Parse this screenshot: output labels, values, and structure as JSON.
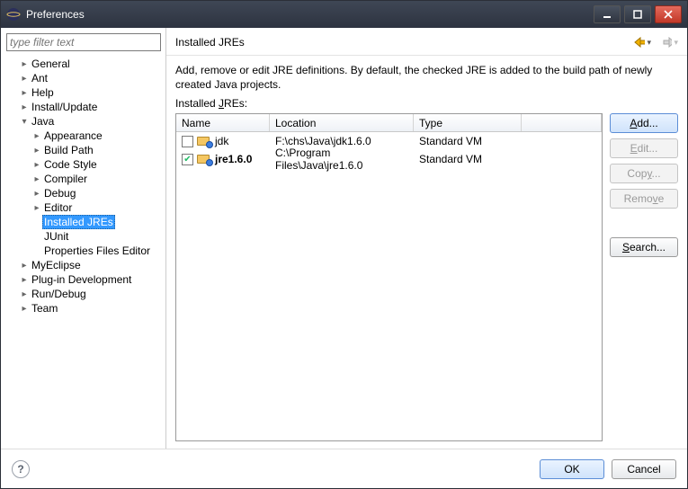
{
  "window": {
    "title": "Preferences"
  },
  "filter": {
    "placeholder": "type filter text"
  },
  "tree": {
    "items": [
      {
        "label": "General",
        "expandable": true,
        "level": 1
      },
      {
        "label": "Ant",
        "expandable": true,
        "level": 1
      },
      {
        "label": "Help",
        "expandable": true,
        "level": 1
      },
      {
        "label": "Install/Update",
        "expandable": true,
        "level": 1
      },
      {
        "label": "Java",
        "expandable": true,
        "expanded": true,
        "level": 1
      },
      {
        "label": "Appearance",
        "expandable": true,
        "level": 2
      },
      {
        "label": "Build Path",
        "expandable": true,
        "level": 2
      },
      {
        "label": "Code Style",
        "expandable": true,
        "level": 2
      },
      {
        "label": "Compiler",
        "expandable": true,
        "level": 2
      },
      {
        "label": "Debug",
        "expandable": true,
        "level": 2
      },
      {
        "label": "Editor",
        "expandable": true,
        "level": 2
      },
      {
        "label": "Installed JREs",
        "expandable": false,
        "level": 2,
        "selected": true
      },
      {
        "label": "JUnit",
        "expandable": false,
        "level": 2
      },
      {
        "label": "Properties Files Editor",
        "expandable": false,
        "level": 2
      },
      {
        "label": "MyEclipse",
        "expandable": true,
        "level": 1
      },
      {
        "label": "Plug-in Development",
        "expandable": true,
        "level": 1
      },
      {
        "label": "Run/Debug",
        "expandable": true,
        "level": 1
      },
      {
        "label": "Team",
        "expandable": true,
        "level": 1
      }
    ]
  },
  "main": {
    "title": "Installed JREs",
    "description": "Add, remove or edit JRE definitions. By default, the checked JRE is added to the build path of newly created Java projects.",
    "list_label_pre": "Installed ",
    "list_label_u": "J",
    "list_label_post": "REs:",
    "columns": {
      "name": "Name",
      "location": "Location",
      "type": "Type"
    },
    "rows": [
      {
        "checked": false,
        "name": "jdk",
        "location": "F:\\chs\\Java\\jdk1.6.0",
        "type": "Standard VM"
      },
      {
        "checked": true,
        "name": "jre1.6.0",
        "location": "C:\\Program Files\\Java\\jre1.6.0",
        "type": "Standard VM"
      }
    ]
  },
  "buttons": {
    "add_pre": "",
    "add_u": "A",
    "add_post": "dd...",
    "edit_pre": "",
    "edit_u": "E",
    "edit_post": "dit...",
    "copy_pre": "Cop",
    "copy_u": "y",
    "copy_post": "...",
    "remove_pre": "Remo",
    "remove_u": "v",
    "remove_post": "e",
    "search_pre": "",
    "search_u": "S",
    "search_post": "earch...",
    "ok": "OK",
    "cancel": "Cancel"
  }
}
